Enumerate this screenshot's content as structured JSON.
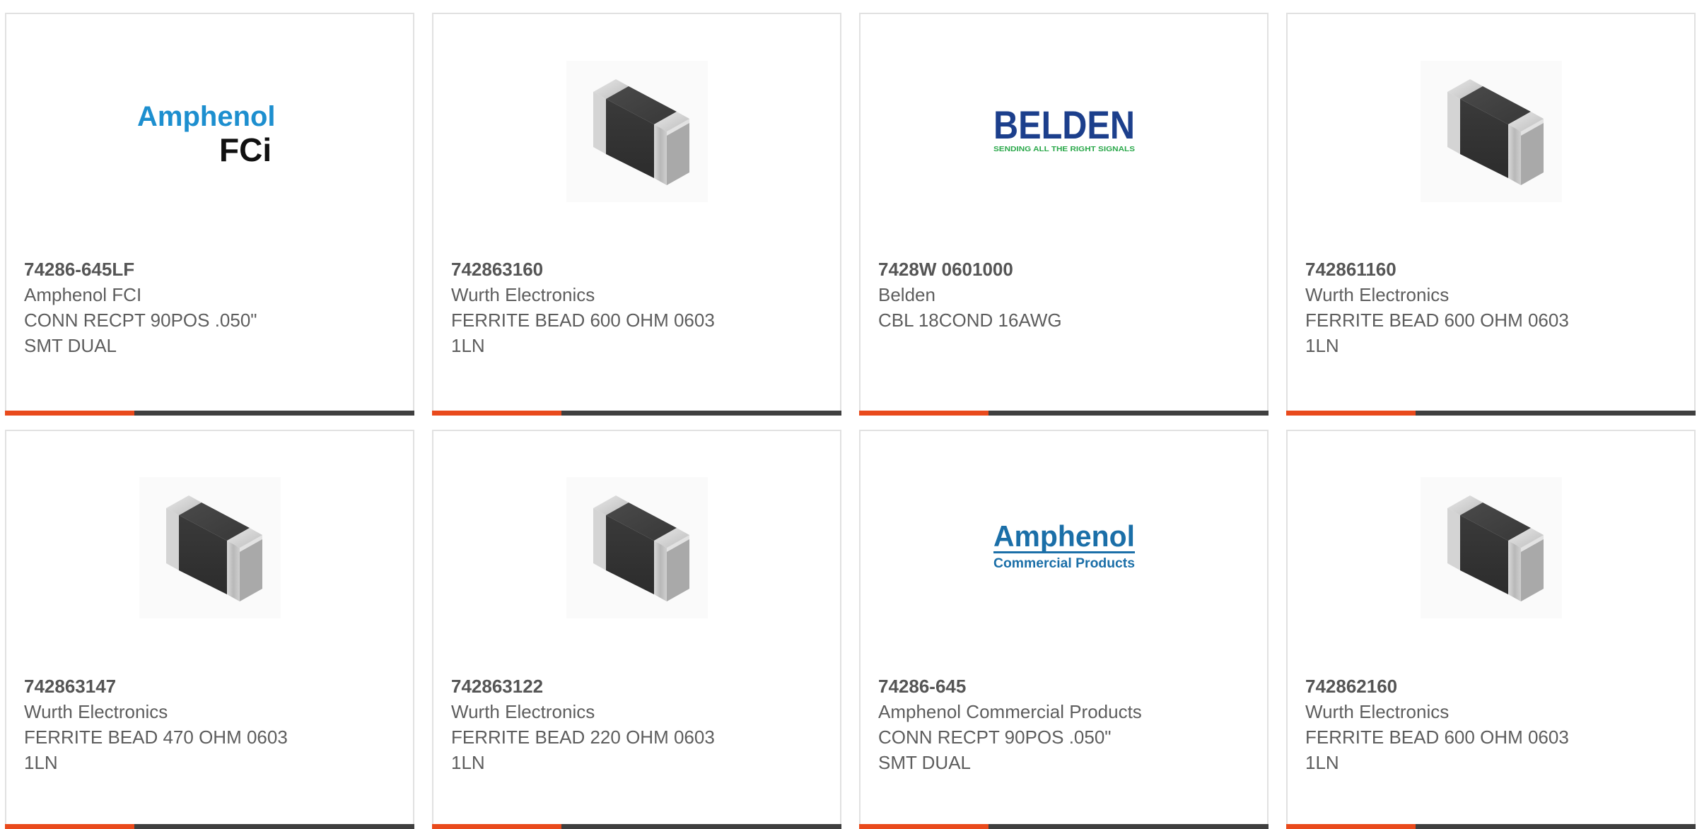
{
  "products": [
    {
      "part_number": "74286-645LF",
      "manufacturer": "Amphenol FCI",
      "description": "CONN RECPT 90POS .050\"\nSMT DUAL",
      "image": "amphenol-fci-logo",
      "logo_text_1": "Amphenol",
      "logo_text_2": "FCi"
    },
    {
      "part_number": "742863160",
      "manufacturer": "Wurth Electronics",
      "description": "FERRITE BEAD 600 OHM 0603\n1LN",
      "image": "ferrite-bead-chip"
    },
    {
      "part_number": "7428W 0601000",
      "manufacturer": "Belden",
      "description": "CBL 18COND 16AWG",
      "image": "belden-logo",
      "logo_text_1": "BELDEN",
      "logo_text_2": "SENDING ALL THE RIGHT SIGNALS"
    },
    {
      "part_number": "742861160",
      "manufacturer": "Wurth Electronics",
      "description": "FERRITE BEAD 600 OHM 0603\n1LN",
      "image": "ferrite-bead-chip"
    },
    {
      "part_number": "742863147",
      "manufacturer": "Wurth Electronics",
      "description": "FERRITE BEAD 470 OHM 0603\n1LN",
      "image": "ferrite-bead-chip"
    },
    {
      "part_number": "742863122",
      "manufacturer": "Wurth Electronics",
      "description": "FERRITE BEAD 220 OHM 0603\n1LN",
      "image": "ferrite-bead-chip"
    },
    {
      "part_number": "74286-645",
      "manufacturer": "Amphenol Commercial Products",
      "description": "CONN RECPT 90POS .050\"\nSMT DUAL",
      "image": "amphenol-commercial-logo",
      "logo_text_1": "Amphenol",
      "logo_text_2": "Commercial Products"
    },
    {
      "part_number": "742862160",
      "manufacturer": "Wurth Electronics",
      "description": "FERRITE BEAD 600 OHM 0603\n1LN",
      "image": "ferrite-bead-chip"
    }
  ],
  "colors": {
    "accent": "#e94a1c",
    "bar": "#3f3f3f",
    "text": "#5d5d5d",
    "amphenol_blue": "#1d8fcf",
    "belden_navy": "#1c3f8c",
    "belden_green": "#2aa84a",
    "amphenol_commercial_blue": "#1b6fa8"
  }
}
